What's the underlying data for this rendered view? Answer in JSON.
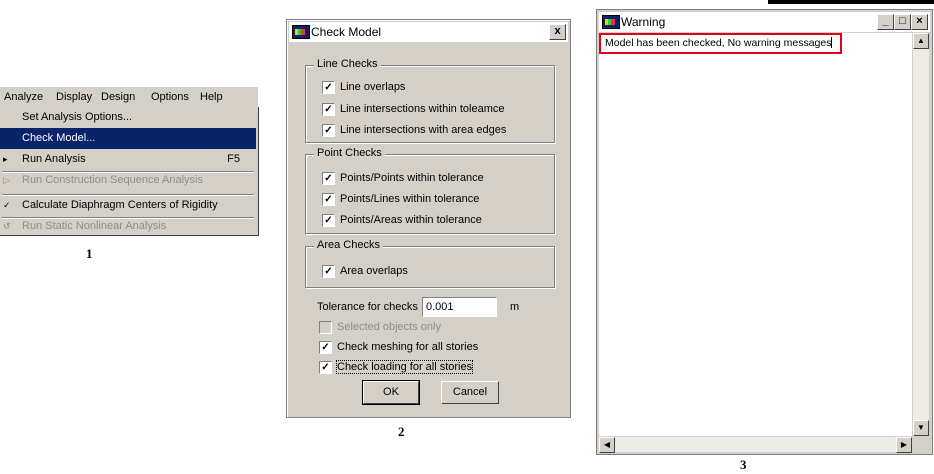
{
  "panel1": {
    "menubar": [
      "Analyze",
      "Display",
      "Design",
      "Options",
      "Help"
    ],
    "items": [
      {
        "label": "Set Analysis Options..."
      },
      {
        "label": "Check Model..."
      },
      {
        "label": "Run Analysis",
        "shortcut": "F5"
      },
      {
        "label": "Run Construction Sequence Analysis"
      },
      {
        "label": "Calculate Diaphragm Centers of Rigidity"
      },
      {
        "label": "Run Static Nonlinear Analysis"
      }
    ],
    "caption": "1"
  },
  "panel2": {
    "title": "Check Model",
    "close": "x",
    "line_checks": {
      "legend": "Line Checks",
      "items": [
        "Line overlaps",
        "Line intersections within toleamce",
        "Line intersections with area edges"
      ]
    },
    "point_checks": {
      "legend": "Point Checks",
      "items": [
        "Points/Points within tolerance",
        "Points/Lines within tolerance",
        "Points/Areas within tolerance"
      ]
    },
    "area_checks": {
      "legend": "Area Checks",
      "items": [
        "Area overlaps"
      ]
    },
    "tolerance_label": "Tolerance for checks",
    "tolerance_value": "0.001",
    "tolerance_unit": "m",
    "selected_only": "Selected objects only",
    "check_meshing": "Check meshing for all stories",
    "check_loading": "Check loading for all stories",
    "ok": "OK",
    "cancel": "Cancel",
    "caption": "2"
  },
  "panel3": {
    "title": "Warning",
    "message": "Model has been checked, No warning messages",
    "caption": "3",
    "highlight_color": "#e0001b"
  },
  "colors": {
    "menu_highlight": "#0a246a",
    "face": "#d4d0c8"
  }
}
